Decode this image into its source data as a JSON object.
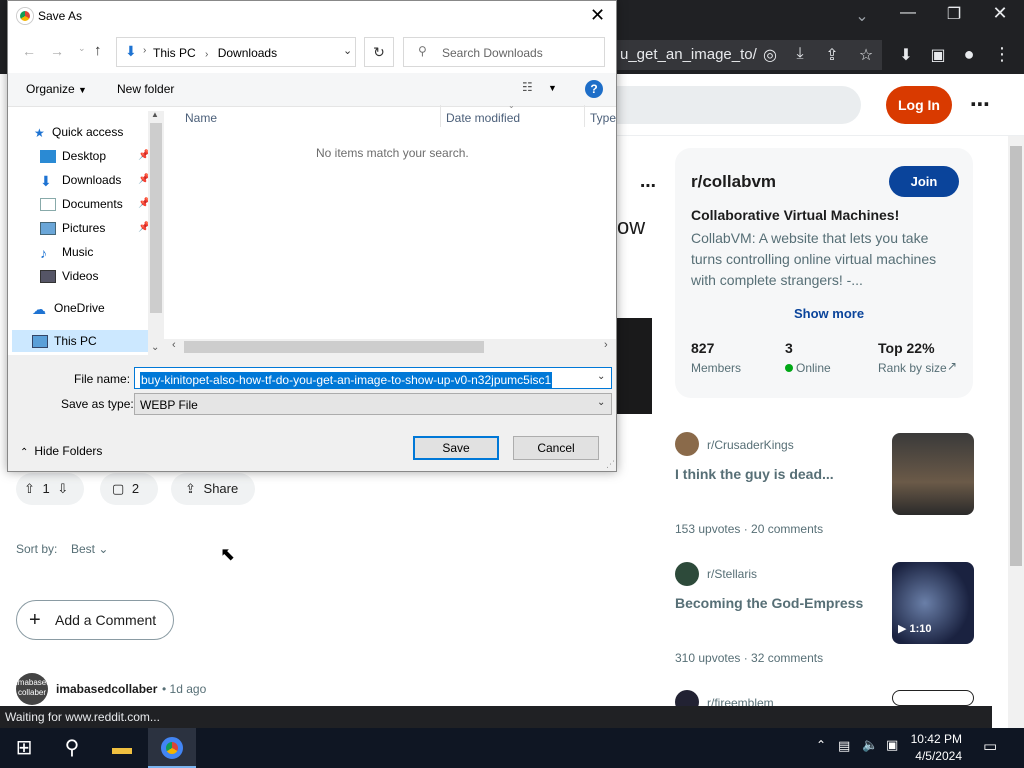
{
  "browser": {
    "omnibox_text": "u_get_an_image_to/",
    "status_text": "Waiting for www.reddit.com..."
  },
  "reddit": {
    "login_label": "Log In",
    "heading_fragment": "ow",
    "sidebar": {
      "subreddit": "r/collabvm",
      "join_label": "Join",
      "title": "Collaborative Virtual Machines!",
      "description": "CollabVM: A website that lets you take turns controlling online virtual machines with complete strangers! -...",
      "show_more": "Show more",
      "stats": [
        {
          "value": "827",
          "label": "Members"
        },
        {
          "value": "3",
          "label": "Online"
        },
        {
          "value": "Top 22%",
          "label": "Rank by size"
        }
      ]
    },
    "related_posts": [
      {
        "sub": "r/CrusaderKings",
        "title": "I think the guy is dead...",
        "meta": "153 upvotes · 20 comments"
      },
      {
        "sub": "r/Stellaris",
        "title": "Becoming the God-Empress",
        "meta": "310 upvotes · 32 comments",
        "duration": "1:10"
      },
      {
        "sub": "r/fireemblem"
      }
    ],
    "actions": {
      "votes": "1",
      "comments": "2",
      "share": "Share"
    },
    "sort_label": "Sort by:",
    "sort_value": "Best",
    "add_comment": "Add a Comment",
    "comment": {
      "avatar_text": "imabased collaber",
      "author": "imabasedcollaber",
      "time": "• 1d ago"
    }
  },
  "dialog": {
    "title": "Save As",
    "address": {
      "root": "This PC",
      "folder": "Downloads"
    },
    "search_placeholder": "Search Downloads",
    "toolbar": {
      "organize": "Organize",
      "new_folder": "New folder"
    },
    "nav": {
      "quick_access": "Quick access",
      "items": [
        "Desktop",
        "Downloads",
        "Documents",
        "Pictures",
        "Music",
        "Videos"
      ],
      "onedrive": "OneDrive",
      "thispc": "This PC"
    },
    "columns": [
      "Name",
      "Date modified",
      "Type"
    ],
    "empty_message": "No items match your search.",
    "file_name_label": "File name:",
    "file_name_value": "buy-kinitopet-also-how-tf-do-you-get-an-image-to-show-up-v0-n32jpumc5isc1",
    "save_type_label": "Save as type:",
    "save_type_value": "WEBP File",
    "hide_folders": "Hide Folders",
    "save_label": "Save",
    "cancel_label": "Cancel"
  },
  "taskbar": {
    "time": "10:42 PM",
    "date": "4/5/2024"
  }
}
